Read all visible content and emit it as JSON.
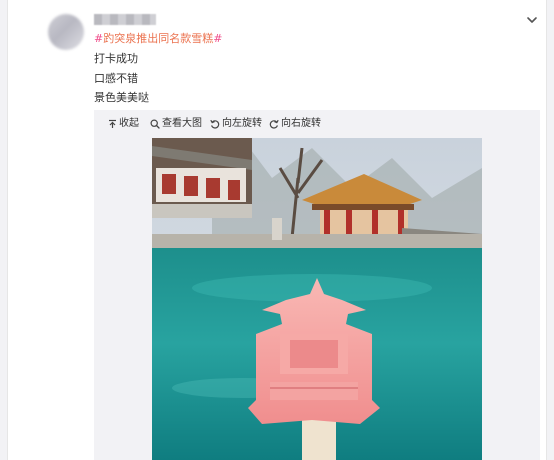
{
  "post": {
    "hashtag_mark_open": "#",
    "hashtag_topic": "趵突泉推出同名款雪糕",
    "hashtag_mark_close": "#",
    "lines": [
      "打卡成功",
      "口感不错",
      "景色美美哒"
    ]
  },
  "toolbar": {
    "collapse_label": "收起",
    "view_large_label": "查看大图",
    "rotate_left_label": "向左旋转",
    "rotate_right_label": "向右旋转"
  },
  "colors": {
    "hashtag_mark": "#f04c8a",
    "hashtag_topic": "#eb7350",
    "panel_bg": "#f2f2f5"
  },
  "icons": [
    "chevron-down-icon",
    "collapse-up-icon",
    "magnifier-icon",
    "rotate-left-icon",
    "rotate-right-icon"
  ]
}
